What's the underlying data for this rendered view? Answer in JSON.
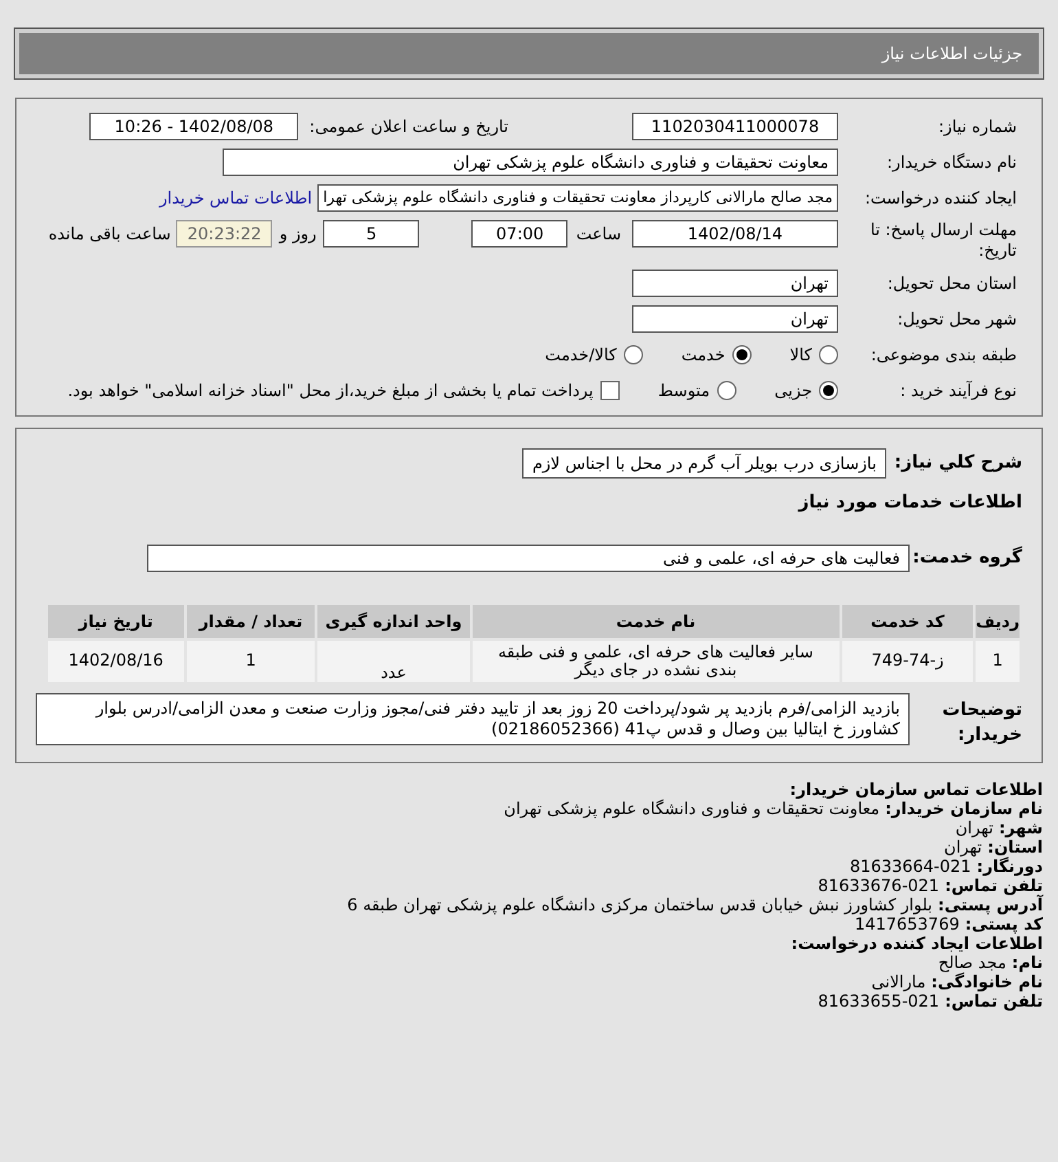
{
  "header": {
    "title": "جزئیات اطلاعات نیاز"
  },
  "need_number": {
    "label": "شماره نیاز:",
    "value": "1102030411000078"
  },
  "announce": {
    "label": "تاریخ و ساعت اعلان عمومی:",
    "value": "1402/08/08 - 10:26"
  },
  "buyer_org": {
    "label": "نام دستگاه خریدار:",
    "value": "معاونت تحقیقات و فناوری دانشگاه علوم پزشکی تهران"
  },
  "requester": {
    "label": "ایجاد کننده درخواست:",
    "value": "مجد صالح مارالانی کارپرداز معاونت تحقیقات و فناوری دانشگاه علوم پزشکی تهرا",
    "link": "اطلاعات تماس خریدار"
  },
  "deadline": {
    "label": "مهلت ارسال پاسخ: تا تاریخ:",
    "date": "1402/08/14",
    "time_label": "ساعت",
    "time": "07:00",
    "days": "5",
    "days_label": "روز و",
    "remaining": "20:23:22",
    "remaining_label": "ساعت باقی مانده"
  },
  "province": {
    "label": "استان محل تحویل:",
    "value": "تهران"
  },
  "city": {
    "label": "شهر محل تحویل:",
    "value": "تهران"
  },
  "category": {
    "label": "طبقه بندی موضوعی:",
    "options": [
      {
        "label": "کالا",
        "selected": false
      },
      {
        "label": "خدمت",
        "selected": true
      },
      {
        "label": "کالا/خدمت",
        "selected": false
      }
    ]
  },
  "process": {
    "label": "نوع فرآیند خرید :",
    "options": [
      {
        "label": "جزیی",
        "selected": true
      },
      {
        "label": "متوسط",
        "selected": false
      }
    ],
    "payment_checkbox": {
      "label": "پرداخت تمام یا بخشی از مبلغ خرید،از محل \"اسناد خزانه اسلامی\" خواهد بود.",
      "checked": false
    }
  },
  "summary": {
    "label": "شرح کلي نياز:",
    "value": "بازسازی درب بویلر آب گرم در محل با اجناس لازم"
  },
  "services_heading": "اطلاعات خدمات مورد نیاز",
  "service_group": {
    "label": "گروه خدمت:",
    "value": "فعالیت های حرفه ای، علمی و فنی"
  },
  "table": {
    "columns": [
      "ردیف",
      "کد خدمت",
      "نام خدمت",
      "واحد اندازه گیری",
      "تعداد / مقدار",
      "تاریخ نیاز"
    ],
    "rows": [
      [
        "1",
        "ز-74-749",
        "سایر فعالیت های حرفه ای، علمی و فنی طبقه بندی نشده در جای دیگر",
        "عدد",
        "1",
        "1402/08/16"
      ]
    ]
  },
  "buyer_notes": {
    "label": "توضیحات خریدار:",
    "value": "بازدید الزامی/فرم بازدید پر شود/پرداخت 20 زوز بعد از تایید دفتر فنی/مجوز وزارت صنعت و معدن الزامی/ادرس بلوار کشاورز خ ایتالیا بین وصال و قدس پ41 (02186052366)"
  },
  "contact": [
    {
      "kind": "heading",
      "label": "اطلاعات تماس سازمان خریدار:"
    },
    {
      "kind": "field",
      "label": "نام سازمان خریدار:",
      "value": "معاونت تحقیقات و فناوری دانشگاه علوم پزشکی تهران"
    },
    {
      "kind": "field",
      "label": "شهر:",
      "value": "تهران"
    },
    {
      "kind": "field",
      "label": "استان:",
      "value": "تهران"
    },
    {
      "kind": "field",
      "label": "دورنگار:",
      "value": "021-81633664"
    },
    {
      "kind": "field",
      "label": "تلفن تماس:",
      "value": "021-81633676"
    },
    {
      "kind": "field",
      "label": "آدرس پستی:",
      "value": "بلوار کشاورز نبش خیابان قدس ساختمان مرکزی دانشگاه علوم پزشکی تهران طبقه 6"
    },
    {
      "kind": "field",
      "label": "کد پستی:",
      "value": "1417653769"
    },
    {
      "kind": "heading",
      "label": "اطلاعات ایجاد کننده درخواست:"
    },
    {
      "kind": "field",
      "label": "نام:",
      "value": "مجد صالح"
    },
    {
      "kind": "field",
      "label": "نام خانوادگی:",
      "value": "مارالانی"
    },
    {
      "kind": "field",
      "label": "تلفن تماس:",
      "value": "021-81633655"
    }
  ]
}
